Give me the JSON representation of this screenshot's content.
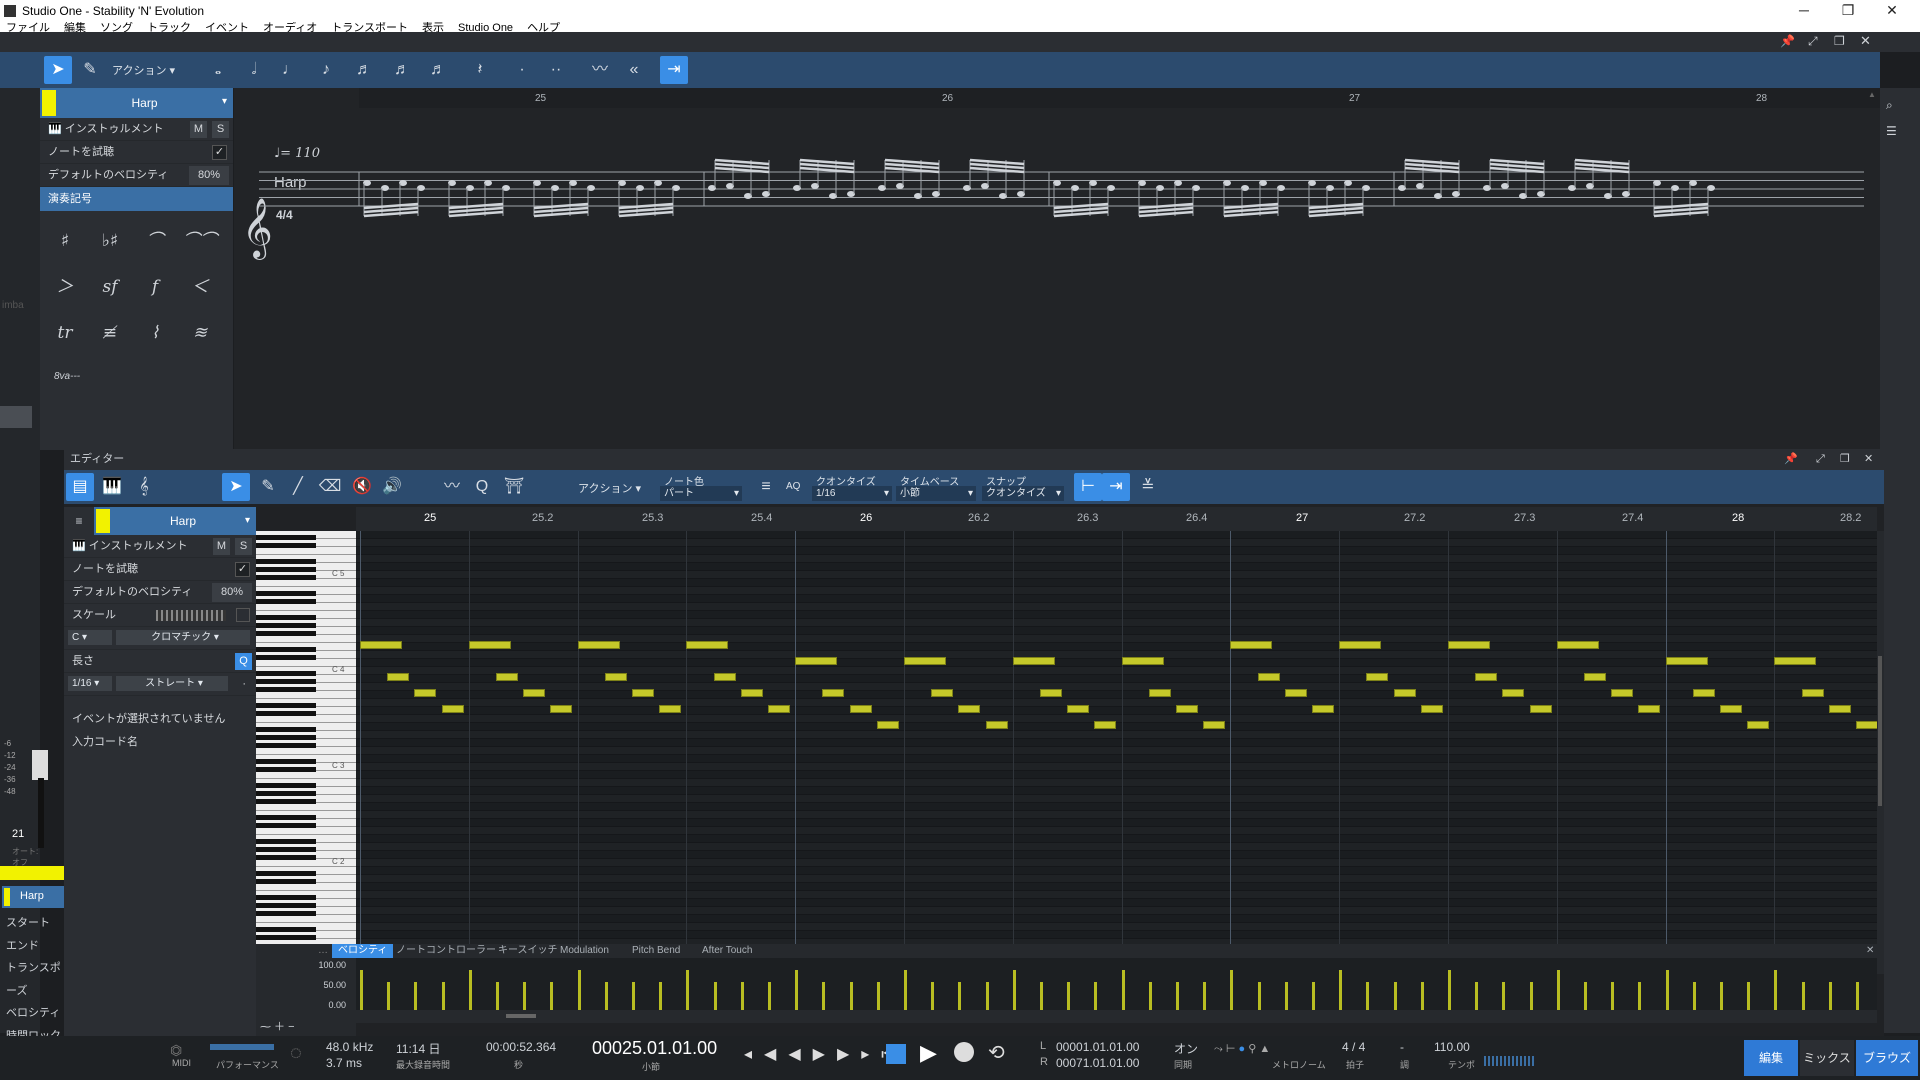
{
  "window": {
    "title": "Studio One - Stability 'N' Evolution",
    "menu": [
      "ファイル",
      "編集",
      "ソング",
      "トラック",
      "イベント",
      "オーディオ",
      "トランスポート",
      "表示",
      "Studio One",
      "ヘルプ"
    ]
  },
  "score_toolbar": {
    "action": "アクション"
  },
  "score_inspector": {
    "track": "Harp",
    "instrument": "インストゥルメント",
    "m": "M",
    "s": "S",
    "audition": "ノートを試聴",
    "audition_check": "✓",
    "default_vel_label": "デフォルトのベロシティ",
    "default_vel": "80%",
    "notation_header": "演奏記号",
    "symbols": [
      "♯",
      "♭♯",
      "⌒",
      "⌒⌒",
      "＞",
      "sf",
      "f",
      "＜",
      "tr",
      "≢",
      "⌇",
      "≋",
      "8va---"
    ]
  },
  "score": {
    "bars": [
      "25",
      "26",
      "27",
      "28"
    ],
    "tempo": "♩= 110",
    "track": "Harp",
    "clef": "𝄞",
    "time": "4/4"
  },
  "left_strip": {
    "partial": "imba",
    "db": [
      "-6",
      "-12",
      "-24",
      "-36",
      "-48"
    ],
    "num": "21",
    "auto": "オート: オフ",
    "track": "Harp",
    "rows": [
      "スタート",
      "エンド",
      "トランスポーズ",
      "ベロシティ",
      "時間ロック"
    ]
  },
  "editor": {
    "title": "エディター",
    "action": "アクション",
    "note_color_label": "ノート色",
    "note_color": "パート",
    "quantize_label": "クオンタイズ",
    "quantize": "1/16",
    "timebase_label": "タイムベース",
    "timebase": "小節",
    "snap_label": "スナップ",
    "snap": "クオンタイズ",
    "aq": "AQ"
  },
  "piano_inspector": {
    "track": "Harp",
    "instrument": "インストゥルメント",
    "m": "M",
    "s": "S",
    "audition": "ノートを試聴",
    "audition_check": "✓",
    "default_vel_label": "デフォルトのベロシティ",
    "default_vel": "80%",
    "scale_label": "スケール",
    "root": "C",
    "scale": "クロマチック",
    "length_label": "長さ",
    "length": "1/16",
    "length_mode": "ストレート",
    "q": "Q",
    "no_event": "イベントが選択されていません",
    "chord_label": "入力コード名"
  },
  "ruler": [
    "25",
    "25.2",
    "25.3",
    "25.4",
    "26",
    "26.2",
    "26.3",
    "26.4",
    "27",
    "27.2",
    "27.3",
    "27.4",
    "28",
    "28.2"
  ],
  "keys": [
    "C 5",
    "C 4",
    "C 3",
    "C 2"
  ],
  "lanes": {
    "tabs": [
      "ベロシティ",
      "ノートコントローラー",
      "キースイッチ",
      "Modulation",
      "Pitch Bend",
      "After Touch"
    ],
    "scale": [
      "100.00",
      "50.00",
      "0.00"
    ]
  },
  "transport": {
    "midi": "MIDI",
    "perf": "パフォーマンス",
    "rate": "48.0 kHz",
    "latency": "3.7 ms",
    "rec_time": "11:14 日",
    "rec_label": "最大録音時間",
    "time": "00:00:52.364",
    "sec": "秒",
    "bars": "00025.01.01.00",
    "bars_label": "小節",
    "L": "L",
    "R": "R",
    "loop_start": "00001.01.01.00",
    "loop_end": "00071.01.01.00",
    "sync": "オン",
    "sync_label": "同期",
    "metro_label": "メトロノーム",
    "sig": "4 / 4",
    "sig_label": "拍子",
    "key": "-",
    "key_label": "調",
    "tempo": "110.00",
    "tempo_label": "テンポ",
    "btn_edit": "編集",
    "btn_mix": "ミックス",
    "btn_browse": "ブラウズ"
  },
  "accent": "#3a8ee6",
  "note_color": "#c5c92a",
  "track_color": "#f2f200"
}
